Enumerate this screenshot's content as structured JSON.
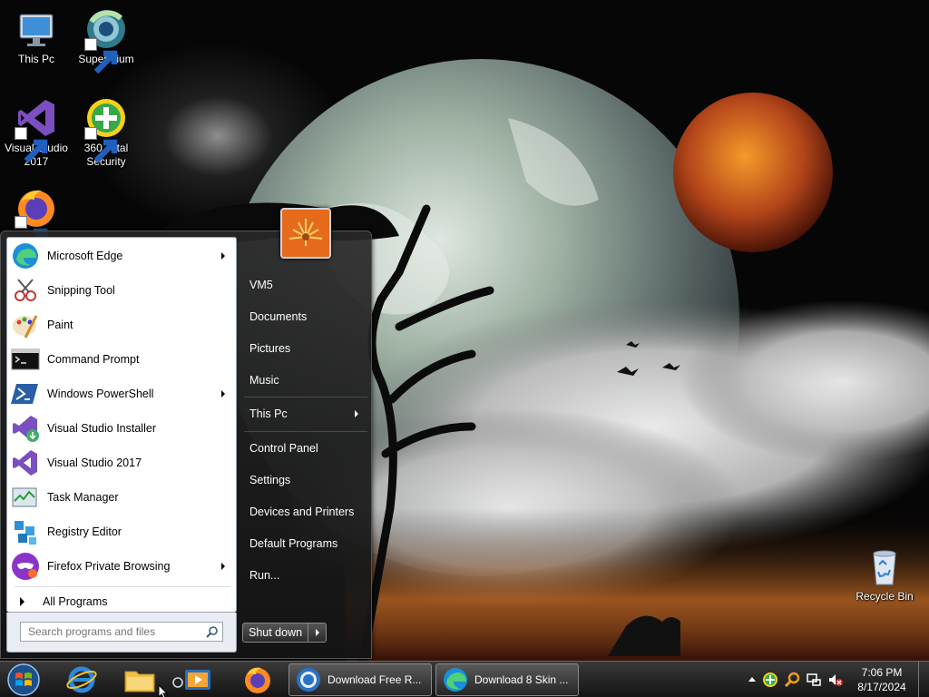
{
  "desktop": {
    "icons": [
      {
        "label": "This Pc"
      },
      {
        "label": "Supermium"
      },
      {
        "label": "Visual Studio 2017"
      },
      {
        "label": "360 Total Security"
      },
      {
        "label": ""
      },
      {
        "label": "Recycle Bin"
      }
    ]
  },
  "start_menu": {
    "programs": [
      {
        "label": "Microsoft Edge",
        "submenu": true
      },
      {
        "label": "Snipping Tool",
        "submenu": false
      },
      {
        "label": "Paint",
        "submenu": false
      },
      {
        "label": "Command Prompt",
        "submenu": false
      },
      {
        "label": "Windows PowerShell",
        "submenu": true
      },
      {
        "label": "Visual Studio Installer",
        "submenu": false
      },
      {
        "label": "Visual Studio 2017",
        "submenu": false
      },
      {
        "label": "Task Manager",
        "submenu": false
      },
      {
        "label": "Registry Editor",
        "submenu": false
      },
      {
        "label": "Firefox Private Browsing",
        "submenu": true
      }
    ],
    "all_programs": "All Programs",
    "search_placeholder": "Search programs and files",
    "right_items": [
      {
        "label": "VM5"
      },
      {
        "label": "Documents"
      },
      {
        "label": "Pictures"
      },
      {
        "label": "Music"
      },
      {
        "label": "This Pc",
        "submenu": true
      },
      {
        "label": "Control Panel"
      },
      {
        "label": "Settings"
      },
      {
        "label": "Devices and Printers"
      },
      {
        "label": "Default Programs"
      },
      {
        "label": "Run..."
      }
    ],
    "shutdown_label": "Shut down"
  },
  "taskbar": {
    "tasks": [
      {
        "label": "Download Free R...",
        "icon": "supermium-icon"
      },
      {
        "label": "Download 8 Skin ...",
        "icon": "edge-icon"
      }
    ],
    "clock": {
      "time": "7:06 PM",
      "date": "8/17/2024"
    }
  },
  "colors": {
    "accent": "#1f6fc4",
    "menu_dark": "#1e1e1e",
    "menu_light": "#ffffff"
  }
}
